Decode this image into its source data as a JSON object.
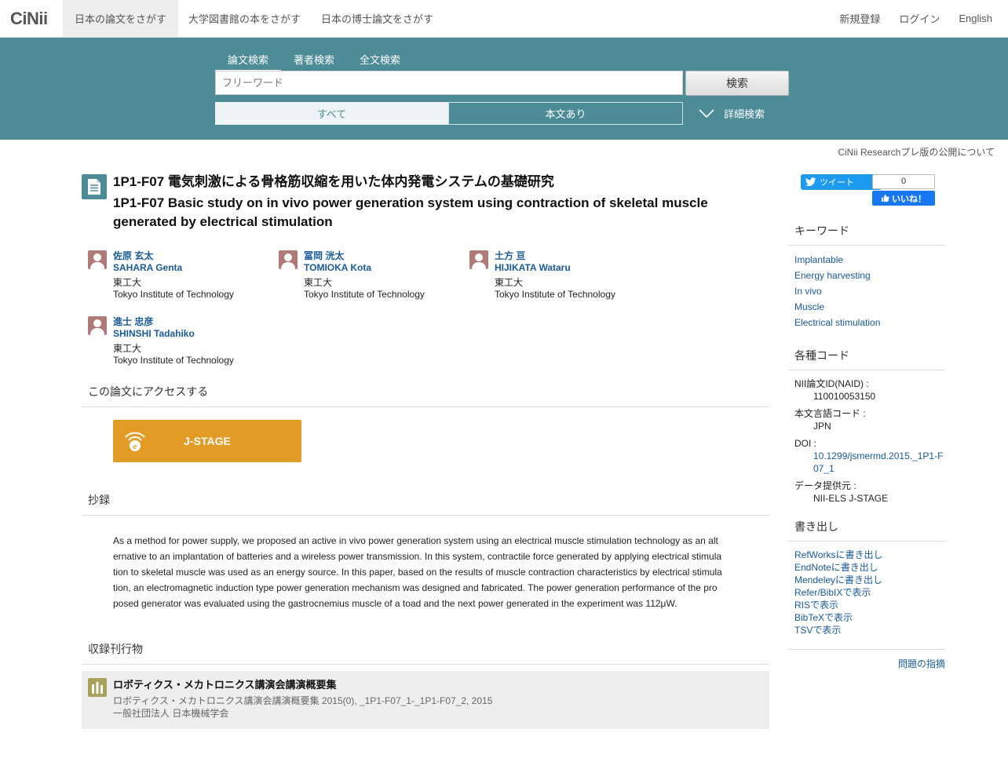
{
  "nav": {
    "logo": "CiNii",
    "tabs": [
      "日本の論文をさがす",
      "大学図書館の本をさがす",
      "日本の博士論文をさがす"
    ],
    "register": "新規登録",
    "login": "ログイン",
    "english": "English"
  },
  "search": {
    "tabs": [
      "論文検索",
      "著者検索",
      "全文検索"
    ],
    "placeholder": "フリーワード",
    "button": "検索",
    "filter_all": "すべて",
    "filter_body": "本文あり",
    "advanced": "詳細検索"
  },
  "notice": "CiNii Researchプレ版の公開について",
  "article": {
    "title_ja": "1P1-F07 電気刺激による骨格筋収縮を用いた体内発電システムの基礎研究",
    "title_en": "1P1-F07 Basic study on in vivo power generation system using contraction of skeletal muscle generated by electrical stimulation",
    "authors": [
      {
        "name_ja": "佐原 玄太",
        "name_en": "SAHARA Genta",
        "aff_ja": "東工大",
        "aff_en": "Tokyo Institute of Technology"
      },
      {
        "name_ja": "冨岡 洸太",
        "name_en": "TOMIOKA Kota",
        "aff_ja": "東工大",
        "aff_en": "Tokyo Institute of Technology"
      },
      {
        "name_ja": "土方 亘",
        "name_en": "HIJIKATA Wataru",
        "aff_ja": "東工大",
        "aff_en": "Tokyo Institute of Technology"
      },
      {
        "name_ja": "進士 忠彦",
        "name_en": "SHINSHI Tadahiko",
        "aff_ja": "東工大",
        "aff_en": "Tokyo Institute of Technology"
      }
    ],
    "access_heading": "この論文にアクセスする",
    "jstage_label": "J-STAGE",
    "abstract_heading": "抄録",
    "abstract": "As a method for power supply, we proposed an active in vivo power generation system using an electrical muscle stimulation technology as an alternative to an implantation of batteries and a wireless power transmission. In this system, contractile force generated by applying electrical stimulation to skeletal muscle was used as an energy source. In this paper, based on the results of muscle contraction characteristics by electrical stimulation, an electromagnetic induction type power generation mechanism was designed and fabricated. The power generation performance of the proposed generator was evaluated using the gastrocnemius muscle of a toad and the next power generated in the experiment was 112μW.",
    "publication_heading": "収録刊行物",
    "publication": {
      "title": "ロボティクス・メカトロニクス講演会講演概要集",
      "detail": "ロボティクス・メカトロニクス講演会講演概要集 2015(0), _1P1-F07_1-_1P1-F07_2, 2015",
      "publisher": "一般社団法人 日本機械学会"
    }
  },
  "sidebar": {
    "tweet": "ツイート",
    "like_count": "0",
    "like_label": "いいね！",
    "keywords_heading": "キーワード",
    "keywords": [
      "Implantable",
      "Energy harvesting",
      "In vivo",
      "Muscle",
      "Electrical stimulation"
    ],
    "codes_heading": "各種コード",
    "codes": {
      "naid_label": "NII論文ID(NAID) :",
      "naid": "110010053150",
      "lang_label": "本文言語コード :",
      "lang": "JPN",
      "doi_label": "DOI :",
      "doi": "10.1299/jsmermd.2015._1P1-F07_1",
      "provider_label": "データ提供元 :",
      "provider": "NII-ELS  J-STAGE"
    },
    "export_heading": "書き出し",
    "exports": [
      "RefWorksに書き出し",
      "EndNoteに書き出し",
      "Mendeleyに書き出し",
      "Refer/BibIXで表示",
      "RISで表示",
      "BibTeXで表示",
      "TSVで表示"
    ],
    "report": "問題の指摘"
  }
}
